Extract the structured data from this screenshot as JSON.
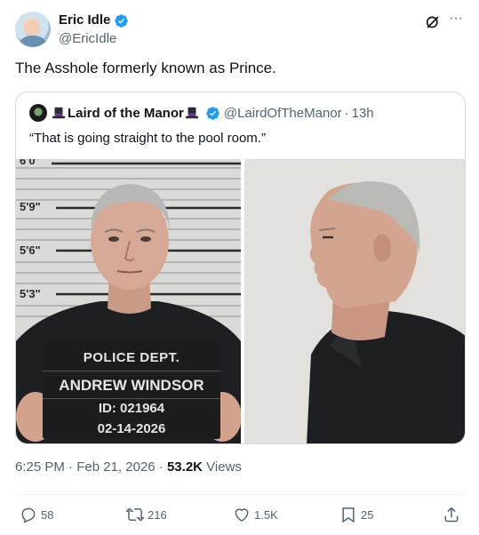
{
  "author": {
    "name": "Eric Idle",
    "handle": "@EricIdle",
    "verified_color": "#1d9bf0"
  },
  "tweet": {
    "text": "The Asshole formerly known as Prince."
  },
  "quoted": {
    "name": "Laird of the Manor",
    "handle": "@LairdOfTheManor",
    "time": "13h",
    "text": "“That is going straight to the pool room.”"
  },
  "mugshot": {
    "height_labels": [
      "6'0\"",
      "5'9\"",
      "5'6\"",
      "5'3\""
    ],
    "placard": {
      "dept": "POLICE DEPT.",
      "name": "ANDREW WINDSOR",
      "id": "ID: 021964",
      "date": "02-14-2026"
    }
  },
  "meta": {
    "time": "6:25 PM",
    "date": "Feb 21, 2026",
    "views_count": "53.2K",
    "views_label": "Views"
  },
  "actions": {
    "replies": "58",
    "reposts": "216",
    "likes": "1.5K",
    "bookmarks": "25"
  },
  "icons": [
    "verified-icon",
    "grok-icon",
    "more-icon",
    "tophat-icon",
    "reply-icon",
    "repost-icon",
    "like-icon",
    "bookmark-icon",
    "share-icon"
  ]
}
